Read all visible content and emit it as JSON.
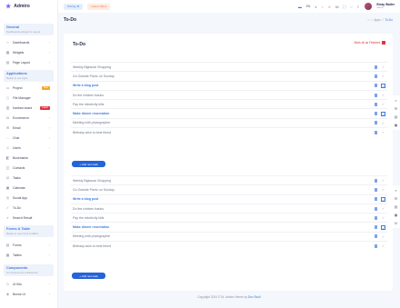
{
  "brand": {
    "name": "Admiro"
  },
  "header": {
    "pill_primary": "Pricing 45",
    "pill_secondary": "Latest Offers",
    "lang": "EN",
    "user_name": "Emay Walter",
    "user_role": "Admin"
  },
  "sidebar": {
    "groups": [
      {
        "title": "General",
        "subtitle": "Dashboards,widgets & Layout"
      },
      {
        "title": "Applications",
        "subtitle": "Ready to use Apps"
      },
      {
        "title": "Forms & Table",
        "subtitle": "Ready to use froms & tables"
      },
      {
        "title": "Components",
        "subtitle": "UI Components & Elements"
      }
    ],
    "general_items": [
      "Dashboards",
      "Widgets",
      "Page Layout"
    ],
    "app_items": [
      "Project",
      "File Manager",
      "Kanban board",
      "Ecommerce",
      "Email",
      "Chat",
      "Users",
      "Bookmarks",
      "Contacts",
      "Tasks",
      "Calendar",
      "Social App",
      "To-Do",
      "Search Result"
    ],
    "project_badge": "New",
    "kanban_badge": "Latest",
    "form_items": [
      "Forms",
      "Tables"
    ],
    "comp_items": [
      "Ui Kits",
      "Bonus Ui"
    ]
  },
  "page": {
    "title": "To-Do",
    "breadcrumb": [
      "Apps",
      "To-Do"
    ]
  },
  "todo": {
    "card_title": "To-Do",
    "mark_all": "Mark all as Finished",
    "add_label": "+ Add new task",
    "tasks": [
      {
        "text": "Weekly Bigbazar Shopping",
        "done": false
      },
      {
        "text": "Go Outside Picnic on Sunday",
        "done": false
      },
      {
        "text": "Write a blog post",
        "done": true
      },
      {
        "text": "Do the chicken basics",
        "done": false
      },
      {
        "text": "Pay the electricity bills",
        "done": false
      },
      {
        "text": "Make dinner reservation",
        "done": true
      },
      {
        "text": "Meeting with photographer",
        "done": false
      },
      {
        "text": "Birthday wish to best friend",
        "done": false
      }
    ]
  },
  "footer": {
    "text": "Copyright 2024 © Dr. Admiro theme by",
    "link": "Dev Studi"
  },
  "icons": {
    "trash": "trash-icon",
    "check": "check-icon",
    "search": "search-icon",
    "gear": "gear-icon"
  }
}
